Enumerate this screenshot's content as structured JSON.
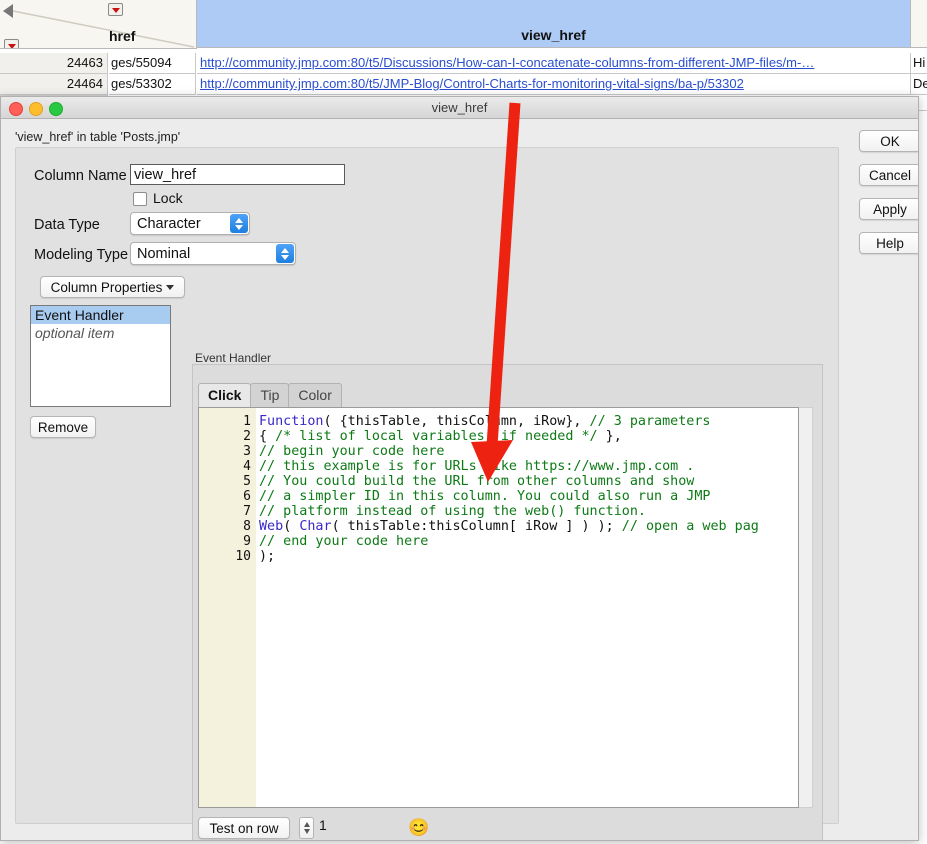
{
  "background_table": {
    "column_headers": {
      "href": "href",
      "view_href": "view_href"
    },
    "rows": [
      {
        "num": "24463",
        "href": "ges/55094",
        "url": "http://community.jmp.com:80/t5/Discussions/How-can-I-concatenate-columns-from-different-JMP-files/m-…",
        "tail": "Hi"
      },
      {
        "num": "24464",
        "href": "ges/53302",
        "url": "http://community.jmp.com:80/t5/JMP-Blog/Control-Charts-for-monitoring-vital-signs/ba-p/53302",
        "tail": "De"
      }
    ]
  },
  "window": {
    "title": "view_href",
    "subtitle": "'view_href' in table 'Posts.jmp'"
  },
  "form": {
    "column_name_label": "Column Name",
    "column_name_value": "view_href",
    "column_name_placeholder": "Column Name",
    "lock_label": "Lock",
    "data_type_label": "Data Type",
    "data_type_value": "Character",
    "modeling_type_label": "Modeling Type",
    "modeling_type_value": "Nominal",
    "column_properties_button": "Column Properties",
    "remove_button": "Remove",
    "property_list": [
      {
        "label": "Event Handler",
        "selected": true
      },
      {
        "label": "optional item",
        "selected": false
      }
    ]
  },
  "event_handler": {
    "caption": "Event Handler",
    "tabs": [
      {
        "label": "Click",
        "active": true
      },
      {
        "label": "Tip",
        "active": false
      },
      {
        "label": "Color",
        "active": false
      }
    ],
    "line_numbers": [
      "1",
      "2",
      "3",
      "4",
      "5",
      "6",
      "7",
      "8",
      "9",
      "10"
    ],
    "code_lines": [
      [
        {
          "t": "Function",
          "c": "kw"
        },
        {
          "t": "( {thisTable, thisColumn, iRow}, ",
          "c": "pl"
        },
        {
          "t": "// 3 parameters",
          "c": "cm"
        }
      ],
      [
        {
          "t": "{ ",
          "c": "pl"
        },
        {
          "t": "/* list of local variables, if needed */",
          "c": "cm"
        },
        {
          "t": " },",
          "c": "pl"
        }
      ],
      [
        {
          "t": "// begin your code here",
          "c": "cm"
        }
      ],
      [
        {
          "t": "// this example is for URLs like https://www.jmp.com .",
          "c": "cm"
        }
      ],
      [
        {
          "t": "// You could build the URL from other columns and show",
          "c": "cm"
        }
      ],
      [
        {
          "t": "// a simpler ID in this column. You could also run a JMP",
          "c": "cm"
        }
      ],
      [
        {
          "t": "// platform instead of using the web() function.",
          "c": "cm"
        }
      ],
      [
        {
          "t": "Web",
          "c": "kw"
        },
        {
          "t": "( ",
          "c": "pl"
        },
        {
          "t": "Char",
          "c": "kw"
        },
        {
          "t": "( thisTable:thisColumn[ iRow ] ) ); ",
          "c": "pl"
        },
        {
          "t": "// open a web pag",
          "c": "cm"
        }
      ],
      [
        {
          "t": "// end your code here",
          "c": "cm"
        }
      ],
      [
        {
          "t": ");",
          "c": "pl"
        }
      ]
    ],
    "test_button": "Test on row",
    "test_row_value": "1",
    "status_emoji": "😊"
  },
  "dialog_buttons": [
    {
      "label": "OK"
    },
    {
      "label": "Cancel"
    },
    {
      "label": "Apply"
    },
    {
      "label": "Help"
    }
  ],
  "annotation": {
    "arrow_color": "#ee2211"
  }
}
